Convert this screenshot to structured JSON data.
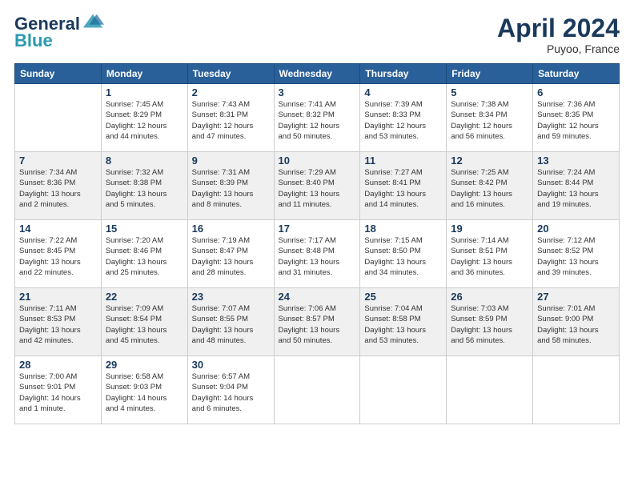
{
  "header": {
    "logo_line1": "General",
    "logo_line2": "Blue",
    "month_title": "April 2024",
    "location": "Puyoo, France"
  },
  "weekdays": [
    "Sunday",
    "Monday",
    "Tuesday",
    "Wednesday",
    "Thursday",
    "Friday",
    "Saturday"
  ],
  "weeks": [
    [
      {
        "day": "",
        "info": ""
      },
      {
        "day": "1",
        "info": "Sunrise: 7:45 AM\nSunset: 8:29 PM\nDaylight: 12 hours\nand 44 minutes."
      },
      {
        "day": "2",
        "info": "Sunrise: 7:43 AM\nSunset: 8:31 PM\nDaylight: 12 hours\nand 47 minutes."
      },
      {
        "day": "3",
        "info": "Sunrise: 7:41 AM\nSunset: 8:32 PM\nDaylight: 12 hours\nand 50 minutes."
      },
      {
        "day": "4",
        "info": "Sunrise: 7:39 AM\nSunset: 8:33 PM\nDaylight: 12 hours\nand 53 minutes."
      },
      {
        "day": "5",
        "info": "Sunrise: 7:38 AM\nSunset: 8:34 PM\nDaylight: 12 hours\nand 56 minutes."
      },
      {
        "day": "6",
        "info": "Sunrise: 7:36 AM\nSunset: 8:35 PM\nDaylight: 12 hours\nand 59 minutes."
      }
    ],
    [
      {
        "day": "7",
        "info": "Sunrise: 7:34 AM\nSunset: 8:36 PM\nDaylight: 13 hours\nand 2 minutes."
      },
      {
        "day": "8",
        "info": "Sunrise: 7:32 AM\nSunset: 8:38 PM\nDaylight: 13 hours\nand 5 minutes."
      },
      {
        "day": "9",
        "info": "Sunrise: 7:31 AM\nSunset: 8:39 PM\nDaylight: 13 hours\nand 8 minutes."
      },
      {
        "day": "10",
        "info": "Sunrise: 7:29 AM\nSunset: 8:40 PM\nDaylight: 13 hours\nand 11 minutes."
      },
      {
        "day": "11",
        "info": "Sunrise: 7:27 AM\nSunset: 8:41 PM\nDaylight: 13 hours\nand 14 minutes."
      },
      {
        "day": "12",
        "info": "Sunrise: 7:25 AM\nSunset: 8:42 PM\nDaylight: 13 hours\nand 16 minutes."
      },
      {
        "day": "13",
        "info": "Sunrise: 7:24 AM\nSunset: 8:44 PM\nDaylight: 13 hours\nand 19 minutes."
      }
    ],
    [
      {
        "day": "14",
        "info": "Sunrise: 7:22 AM\nSunset: 8:45 PM\nDaylight: 13 hours\nand 22 minutes."
      },
      {
        "day": "15",
        "info": "Sunrise: 7:20 AM\nSunset: 8:46 PM\nDaylight: 13 hours\nand 25 minutes."
      },
      {
        "day": "16",
        "info": "Sunrise: 7:19 AM\nSunset: 8:47 PM\nDaylight: 13 hours\nand 28 minutes."
      },
      {
        "day": "17",
        "info": "Sunrise: 7:17 AM\nSunset: 8:48 PM\nDaylight: 13 hours\nand 31 minutes."
      },
      {
        "day": "18",
        "info": "Sunrise: 7:15 AM\nSunset: 8:50 PM\nDaylight: 13 hours\nand 34 minutes."
      },
      {
        "day": "19",
        "info": "Sunrise: 7:14 AM\nSunset: 8:51 PM\nDaylight: 13 hours\nand 36 minutes."
      },
      {
        "day": "20",
        "info": "Sunrise: 7:12 AM\nSunset: 8:52 PM\nDaylight: 13 hours\nand 39 minutes."
      }
    ],
    [
      {
        "day": "21",
        "info": "Sunrise: 7:11 AM\nSunset: 8:53 PM\nDaylight: 13 hours\nand 42 minutes."
      },
      {
        "day": "22",
        "info": "Sunrise: 7:09 AM\nSunset: 8:54 PM\nDaylight: 13 hours\nand 45 minutes."
      },
      {
        "day": "23",
        "info": "Sunrise: 7:07 AM\nSunset: 8:55 PM\nDaylight: 13 hours\nand 48 minutes."
      },
      {
        "day": "24",
        "info": "Sunrise: 7:06 AM\nSunset: 8:57 PM\nDaylight: 13 hours\nand 50 minutes."
      },
      {
        "day": "25",
        "info": "Sunrise: 7:04 AM\nSunset: 8:58 PM\nDaylight: 13 hours\nand 53 minutes."
      },
      {
        "day": "26",
        "info": "Sunrise: 7:03 AM\nSunset: 8:59 PM\nDaylight: 13 hours\nand 56 minutes."
      },
      {
        "day": "27",
        "info": "Sunrise: 7:01 AM\nSunset: 9:00 PM\nDaylight: 13 hours\nand 58 minutes."
      }
    ],
    [
      {
        "day": "28",
        "info": "Sunrise: 7:00 AM\nSunset: 9:01 PM\nDaylight: 14 hours\nand 1 minute."
      },
      {
        "day": "29",
        "info": "Sunrise: 6:58 AM\nSunset: 9:03 PM\nDaylight: 14 hours\nand 4 minutes."
      },
      {
        "day": "30",
        "info": "Sunrise: 6:57 AM\nSunset: 9:04 PM\nDaylight: 14 hours\nand 6 minutes."
      },
      {
        "day": "",
        "info": ""
      },
      {
        "day": "",
        "info": ""
      },
      {
        "day": "",
        "info": ""
      },
      {
        "day": "",
        "info": ""
      }
    ]
  ]
}
